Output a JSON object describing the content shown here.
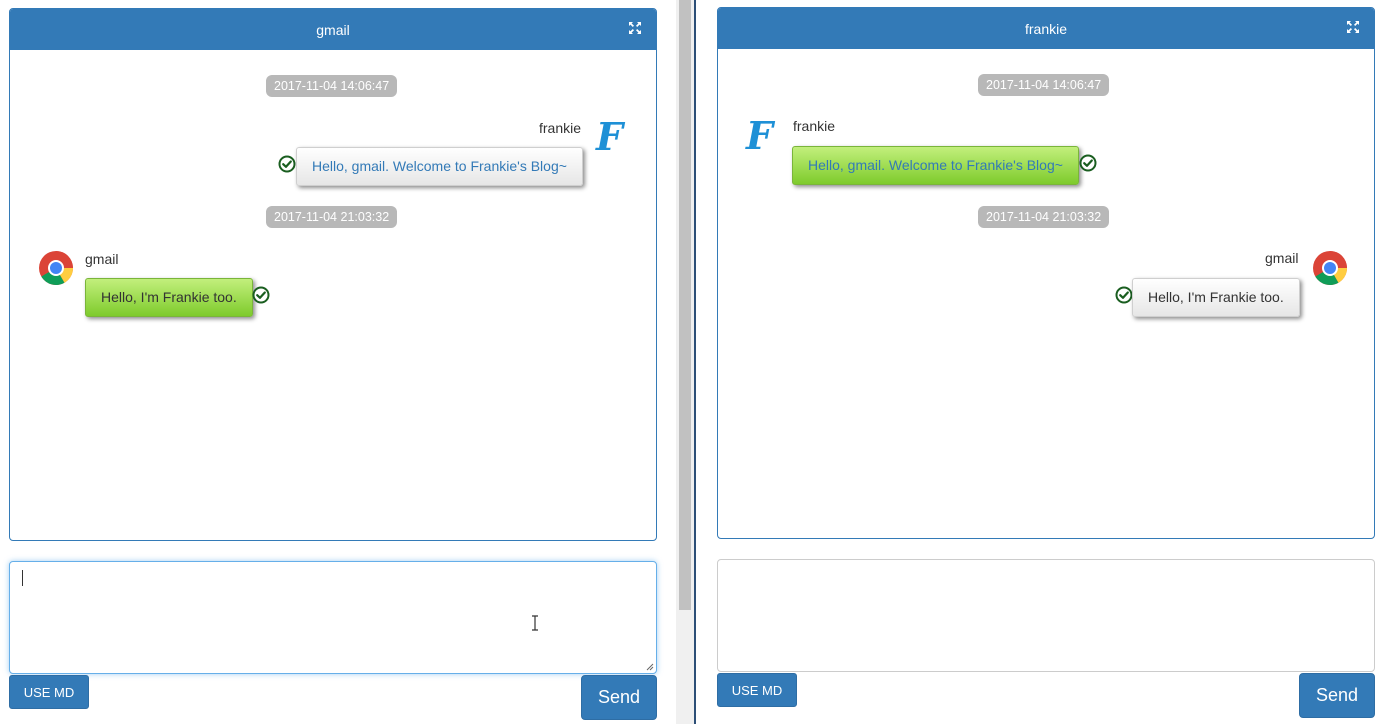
{
  "left": {
    "title": "gmail",
    "messages": [
      {
        "time": "2017-11-04 14:06:47",
        "sender": "frankie",
        "text": "Hello, gmail. Welcome to Frankie's Blog~"
      },
      {
        "time": "2017-11-04 21:03:32",
        "sender": "gmail",
        "text": "Hello, I'm Frankie too."
      }
    ],
    "composer_value": "",
    "use_md_label": "USE MD",
    "send_label": "Send"
  },
  "right": {
    "title": "frankie",
    "messages": [
      {
        "time": "2017-11-04 14:06:47",
        "sender": "frankie",
        "text": "Hello, gmail. Welcome to Frankie's Blog~"
      },
      {
        "time": "2017-11-04 21:03:32",
        "sender": "gmail",
        "text": "Hello, I'm Frankie too."
      }
    ],
    "composer_value": "",
    "use_md_label": "USE MD",
    "send_label": "Send"
  },
  "avatars": {
    "frankie": {
      "icon": "frankie-logo-icon",
      "letter": "F",
      "color": "#1e90d6"
    },
    "gmail": {
      "icon": "chrome-icon"
    }
  },
  "colors": {
    "primary": "#337ab7",
    "sent_bubble_green": "#8fd43c",
    "received_bubble": "#f2f2f2",
    "check_green": "#1a5e20",
    "timestamp_bg": "#b8b8b8"
  }
}
